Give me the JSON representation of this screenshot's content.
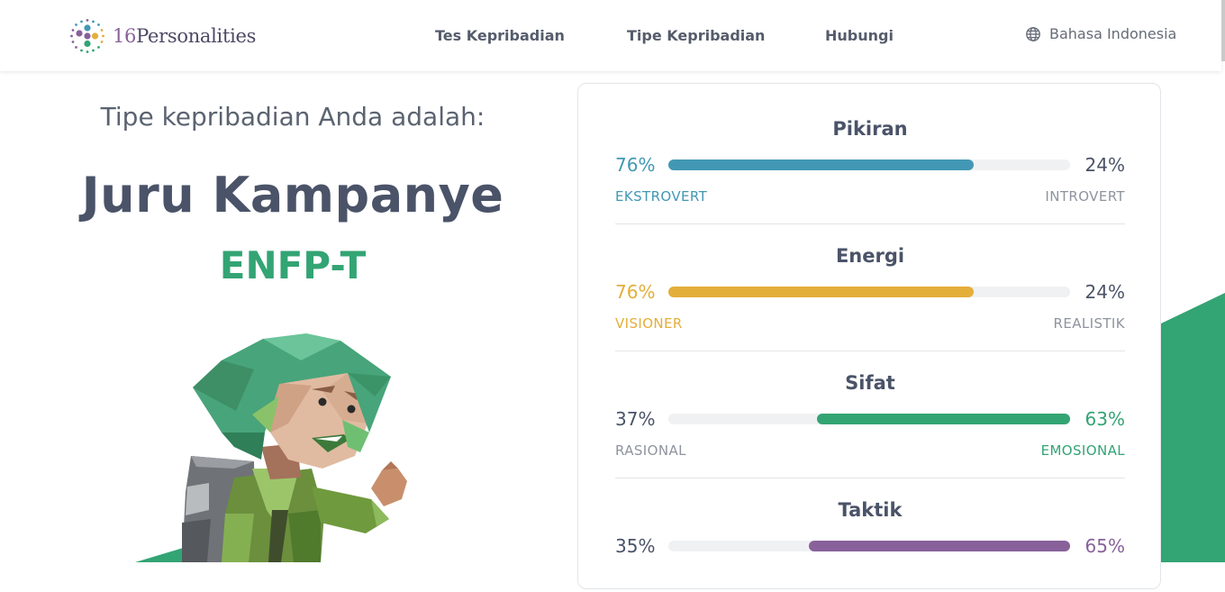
{
  "header": {
    "logo": {
      "number": "16",
      "word": "Personalities"
    },
    "nav": [
      "Tes Kepribadian",
      "Tipe Kepribadian",
      "Hubungi"
    ],
    "language": {
      "icon": "globe-icon",
      "label": "Bahasa Indonesia"
    }
  },
  "result": {
    "intro": "Tipe kepribadian Anda adalah:",
    "type_name": "Juru Kampanye",
    "type_code": "ENFP-T"
  },
  "traits": [
    {
      "title": "Pikiran",
      "left_pct": "76%",
      "right_pct": "24%",
      "left_label": "EKSTROVERT",
      "right_label": "INTROVERT",
      "dominant": "left",
      "fraction": 0.76,
      "color": "#4298b4"
    },
    {
      "title": "Energi",
      "left_pct": "76%",
      "right_pct": "24%",
      "left_label": "VISIONER",
      "right_label": "REALISTIK",
      "dominant": "left",
      "fraction": 0.76,
      "color": "#e4ae3a"
    },
    {
      "title": "Sifat",
      "left_pct": "37%",
      "right_pct": "63%",
      "left_label": "RASIONAL",
      "right_label": "EMOSIONAL",
      "dominant": "right",
      "fraction": 0.63,
      "color": "#33a474"
    },
    {
      "title": "Taktik",
      "left_pct": "35%",
      "right_pct": "65%",
      "left_label": "",
      "right_label": "",
      "dominant": "right",
      "fraction": 0.65,
      "color": "#88619a"
    }
  ],
  "colors": {
    "accent_green": "#33a474",
    "text_dark": "#4a5368",
    "muted": "#8e949e"
  }
}
